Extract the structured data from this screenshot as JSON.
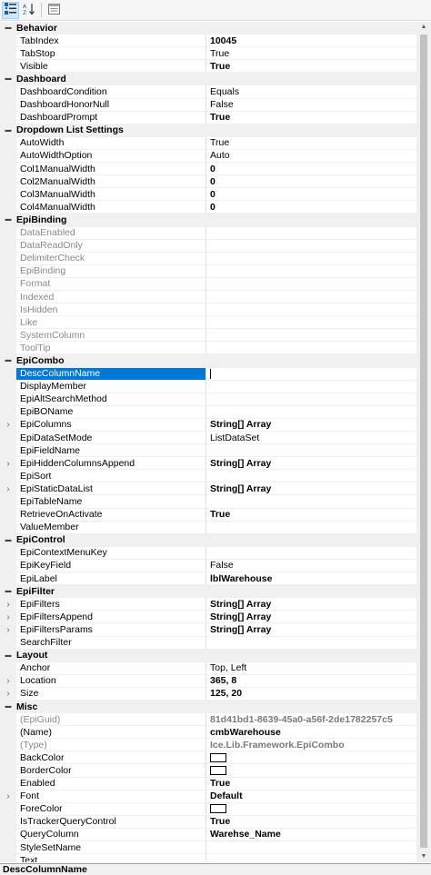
{
  "toolbar": {
    "buttons": [
      {
        "icon": "categorized-icon",
        "active": true
      },
      {
        "icon": "alphabetical-icon",
        "active": false
      },
      {
        "icon": "property-pages-icon",
        "active": false
      }
    ]
  },
  "categories": [
    {
      "name": "Behavior",
      "props": [
        {
          "name": "TabIndex",
          "value": "10045",
          "style": "bold"
        },
        {
          "name": "TabStop",
          "value": "True"
        },
        {
          "name": "Visible",
          "value": "True",
          "style": "bold"
        }
      ]
    },
    {
      "name": "Dashboard",
      "props": [
        {
          "name": "DashboardCondition",
          "value": "Equals"
        },
        {
          "name": "DashboardHonorNull",
          "value": "False"
        },
        {
          "name": "DashboardPrompt",
          "value": "True",
          "style": "bold"
        }
      ]
    },
    {
      "name": "Dropdown List Settings",
      "props": [
        {
          "name": "AutoWidth",
          "value": "True"
        },
        {
          "name": "AutoWidthOption",
          "value": "Auto"
        },
        {
          "name": "Col1ManualWidth",
          "value": "0",
          "style": "bold"
        },
        {
          "name": "Col2ManualWidth",
          "value": "0",
          "style": "bold"
        },
        {
          "name": "Col3ManualWidth",
          "value": "0",
          "style": "bold"
        },
        {
          "name": "Col4ManualWidth",
          "value": "0",
          "style": "bold"
        }
      ]
    },
    {
      "name": "EpiBinding",
      "props": [
        {
          "name": "DataEnabled",
          "value": "",
          "readonly": true
        },
        {
          "name": "DataReadOnly",
          "value": "",
          "readonly": true
        },
        {
          "name": "DelimiterCheck",
          "value": "",
          "readonly": true
        },
        {
          "name": "EpiBinding",
          "value": "",
          "readonly": true
        },
        {
          "name": "Format",
          "value": "",
          "readonly": true
        },
        {
          "name": "Indexed",
          "value": "",
          "readonly": true
        },
        {
          "name": "IsHidden",
          "value": "",
          "readonly": true
        },
        {
          "name": "Like",
          "value": "",
          "readonly": true
        },
        {
          "name": "SystemColumn",
          "value": "",
          "readonly": true
        },
        {
          "name": "ToolTip",
          "value": "",
          "readonly": true
        }
      ]
    },
    {
      "name": "EpiCombo",
      "props": [
        {
          "name": "DescColumnName",
          "value": "",
          "selected": true,
          "caret": true
        },
        {
          "name": "DisplayMember",
          "value": ""
        },
        {
          "name": "EpiAltSearchMethod",
          "value": ""
        },
        {
          "name": "EpiBOName",
          "value": ""
        },
        {
          "name": "EpiColumns",
          "value": "String[] Array",
          "style": "bold",
          "expand": true
        },
        {
          "name": "EpiDataSetMode",
          "value": "ListDataSet"
        },
        {
          "name": "EpiFieldName",
          "value": ""
        },
        {
          "name": "EpiHiddenColumnsAppend",
          "value": "String[] Array",
          "style": "bold",
          "expand": true
        },
        {
          "name": "EpiSort",
          "value": ""
        },
        {
          "name": "EpiStaticDataList",
          "value": "String[] Array",
          "style": "bold",
          "expand": true
        },
        {
          "name": "EpiTableName",
          "value": ""
        },
        {
          "name": "RetrieveOnActivate",
          "value": "True",
          "style": "bold"
        },
        {
          "name": "ValueMember",
          "value": ""
        }
      ]
    },
    {
      "name": "EpiControl",
      "props": [
        {
          "name": "EpiContextMenuKey",
          "value": ""
        },
        {
          "name": "EpiKeyField",
          "value": "False"
        },
        {
          "name": "EpiLabel",
          "value": "lblWarehouse",
          "style": "bold"
        }
      ]
    },
    {
      "name": "EpiFilter",
      "props": [
        {
          "name": "EpiFilters",
          "value": "String[] Array",
          "style": "bold",
          "expand": true
        },
        {
          "name": "EpiFiltersAppend",
          "value": "String[] Array",
          "style": "bold",
          "expand": true
        },
        {
          "name": "EpiFiltersParams",
          "value": "String[] Array",
          "style": "bold",
          "expand": true
        },
        {
          "name": "SearchFilter",
          "value": ""
        }
      ]
    },
    {
      "name": "Layout",
      "props": [
        {
          "name": "Anchor",
          "value": "Top, Left"
        },
        {
          "name": "Location",
          "value": "365, 8",
          "style": "bold",
          "expand": true
        },
        {
          "name": "Size",
          "value": "125, 20",
          "style": "bold",
          "expand": true
        }
      ]
    },
    {
      "name": "Misc",
      "props": [
        {
          "name": "(EpiGuid)",
          "value": "81d41bd1-8639-45a0-a56f-2de1782257c5",
          "style": "grey",
          "readonly": true
        },
        {
          "name": "(Name)",
          "value": "cmbWarehouse",
          "style": "bold"
        },
        {
          "name": "(Type)",
          "value": "Ice.Lib.Framework.EpiCombo",
          "style": "grey",
          "readonly": true
        },
        {
          "name": "BackColor",
          "value": "",
          "swatch": true
        },
        {
          "name": "BorderColor",
          "value": "",
          "swatch": true
        },
        {
          "name": "Enabled",
          "value": "True",
          "style": "bold"
        },
        {
          "name": "Font",
          "value": "Default",
          "style": "bold",
          "expand": true
        },
        {
          "name": "ForeColor",
          "value": "",
          "swatch": true
        },
        {
          "name": "IsTrackerQueryControl",
          "value": "True",
          "style": "bold"
        },
        {
          "name": "QueryColumn",
          "value": "Warehse_Name",
          "style": "bold"
        },
        {
          "name": "StyleSetName",
          "value": ""
        },
        {
          "name": "Text",
          "value": ""
        }
      ]
    }
  ],
  "description": {
    "title": "DescColumnName"
  },
  "colors": {
    "selection": "#0078d7",
    "category_bg": "#f0f0f0",
    "readonly_text": "#8a8a8a"
  }
}
